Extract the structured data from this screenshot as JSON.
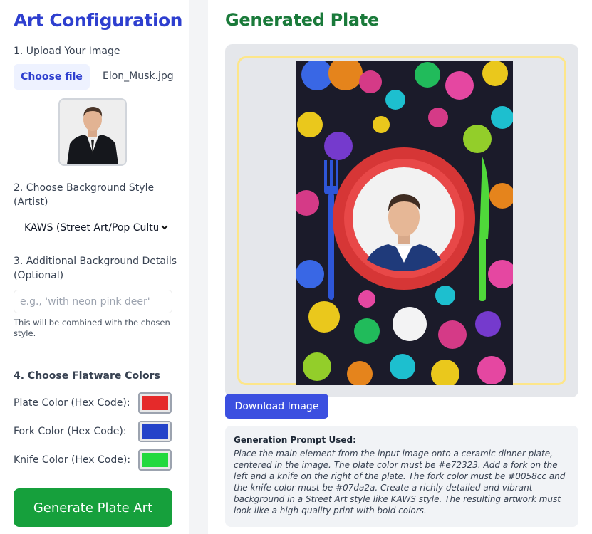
{
  "sidebar": {
    "title": "Art Configuration",
    "upload": {
      "label": "1. Upload Your Image",
      "button_label": "Choose file",
      "file_name": "Elon_Musk.jpg"
    },
    "style": {
      "label": "2. Choose Background Style (Artist)",
      "selected": "KAWS (Street Art/Pop Culture)"
    },
    "details": {
      "label": "3. Additional Background Details (Optional)",
      "placeholder": "e.g., 'with neon pink deer'",
      "hint": "This will be combined with the chosen style."
    },
    "flatware": {
      "heading": "4. Choose Flatware Colors",
      "plate_label": "Plate Color (Hex Code):",
      "fork_label": "Fork Color (Hex Code):",
      "knife_label": "Knife Color (Hex Code):",
      "plate_color": "#e72323",
      "fork_color": "#0058cc",
      "knife_color": "#07da2a"
    },
    "generate_label": "Generate Plate Art"
  },
  "main": {
    "title": "Generated Plate",
    "download_label": "Download Image",
    "prompt_title": "Generation Prompt Used:",
    "prompt_text": "Place the main element from the input image onto a ceramic dinner plate, centered in the image. The plate color must be #e72323. Add a fork on the left and a knife on the right of the plate. The fork color must be #0058cc and the knife color must be #07da2a. Create a richly detailed and vibrant background in a Street Art style like KAWS style. The resulting artwork must look like a high-quality print with bold colors."
  },
  "colors": {
    "accent_blue": "#2e3fcf",
    "accent_green": "#1a7a3a",
    "generate_green": "#16a03c",
    "download_blue": "#3b4fe0"
  }
}
